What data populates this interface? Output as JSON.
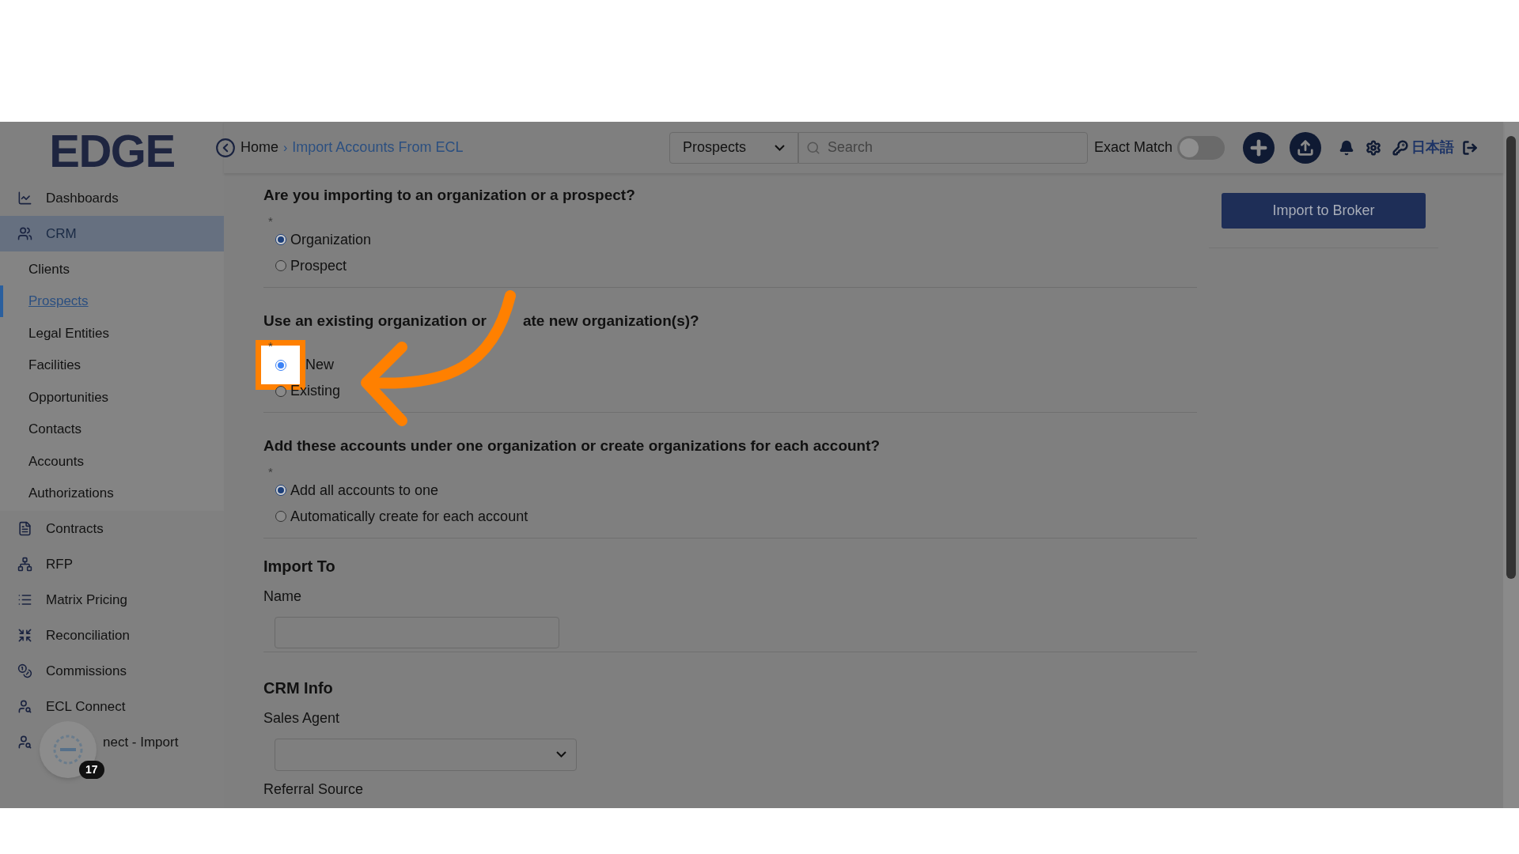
{
  "header": {
    "logo": "EDGE",
    "breadcrumb": [
      {
        "label": "Home",
        "current": false
      },
      {
        "separator": "›",
        "label": "Import Accounts From ECL",
        "current": true
      }
    ],
    "scope_select": "Prospects",
    "search": {
      "placeholder": "Search"
    },
    "exact_match": {
      "label": "Exact Match",
      "on": false
    },
    "language": "日本語"
  },
  "sidebar": {
    "items": [
      {
        "label": "Dashboards",
        "selected": false
      },
      {
        "label": "CRM",
        "selected": true,
        "expanded": true,
        "children": [
          {
            "label": "Clients",
            "selected": false
          },
          {
            "label": "Prospects",
            "selected": true
          },
          {
            "label": "Legal Entities",
            "selected": false
          },
          {
            "label": "Facilities",
            "selected": false
          },
          {
            "label": "Opportunities",
            "selected": false
          },
          {
            "label": "Contacts",
            "selected": false
          },
          {
            "label": "Accounts",
            "selected": false
          },
          {
            "label": "Authorizations",
            "selected": false
          }
        ]
      },
      {
        "label": "Contracts",
        "selected": false
      },
      {
        "label": "RFP",
        "selected": false
      },
      {
        "label": "Matrix Pricing",
        "selected": false
      },
      {
        "label": "Reconciliation",
        "selected": false
      },
      {
        "label": "Commissions",
        "selected": false
      },
      {
        "label": "ECL Connect",
        "selected": false
      },
      {
        "label": "nect - Import",
        "selected": false
      }
    ]
  },
  "widget": {
    "badge": "17"
  },
  "questions": [
    {
      "title_parts": [
        "Are you importing to an organization or a prospect?"
      ],
      "marker": "*",
      "options": [
        {
          "label": "Organization",
          "selected": true,
          "highlighted": false
        },
        {
          "label": "Prospect",
          "selected": false,
          "highlighted": false
        }
      ]
    },
    {
      "title_parts": [
        "Use an existing organization or",
        "ate new organization(s)?"
      ],
      "marker": "*",
      "options": [
        {
          "label": "New",
          "selected": true,
          "highlighted": true
        },
        {
          "label": "Existing",
          "selected": false,
          "highlighted": false
        }
      ]
    },
    {
      "title_parts": [
        "Add these accounts under one organization or create organizations for each account?"
      ],
      "marker": "*",
      "options": [
        {
          "label": "Add all accounts to one",
          "selected": true,
          "highlighted": false
        },
        {
          "label": "Automatically create for each account",
          "selected": false,
          "highlighted": false
        }
      ]
    }
  ],
  "sections": [
    {
      "title": "Import To",
      "fields": [
        {
          "label": "Name",
          "kind": "text"
        }
      ]
    },
    {
      "title": "CRM Info",
      "fields": [
        {
          "label": "Sales Agent",
          "kind": "select"
        },
        {
          "label": "Referral Source",
          "kind": "label"
        }
      ]
    }
  ],
  "import_button": "Import to Broker"
}
